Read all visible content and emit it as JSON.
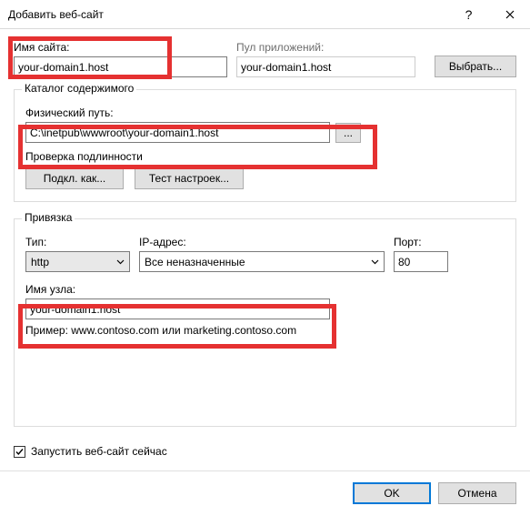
{
  "window": {
    "title": "Добавить веб-сайт",
    "help": "?",
    "close": "✕"
  },
  "site": {
    "name_label": "Имя сайта:",
    "name_value": "your-domain1.host",
    "pool_label": "Пул приложений:",
    "pool_value": "your-domain1.host",
    "choose_btn": "Выбрать..."
  },
  "content": {
    "group": "Каталог содержимого",
    "path_label": "Физический путь:",
    "path_value": "C:\\inetpub\\wwwroot\\your-domain1.host",
    "browse_btn": "...",
    "auth_label": "Проверка подлинности",
    "connect_as_btn": "Подкл. как...",
    "test_btn": "Тест настроек..."
  },
  "binding": {
    "group": "Привязка",
    "type_label": "Тип:",
    "type_value": "http",
    "ip_label": "IP-адрес:",
    "ip_value": "Все неназначенные",
    "port_label": "Порт:",
    "port_value": "80",
    "host_label": "Имя узла:",
    "host_value": "your-domain1.host",
    "example": "Пример: www.contoso.com или marketing.contoso.com"
  },
  "start": {
    "label": "Запустить веб-сайт сейчас"
  },
  "buttons": {
    "ok": "OK",
    "cancel": "Отмена"
  }
}
